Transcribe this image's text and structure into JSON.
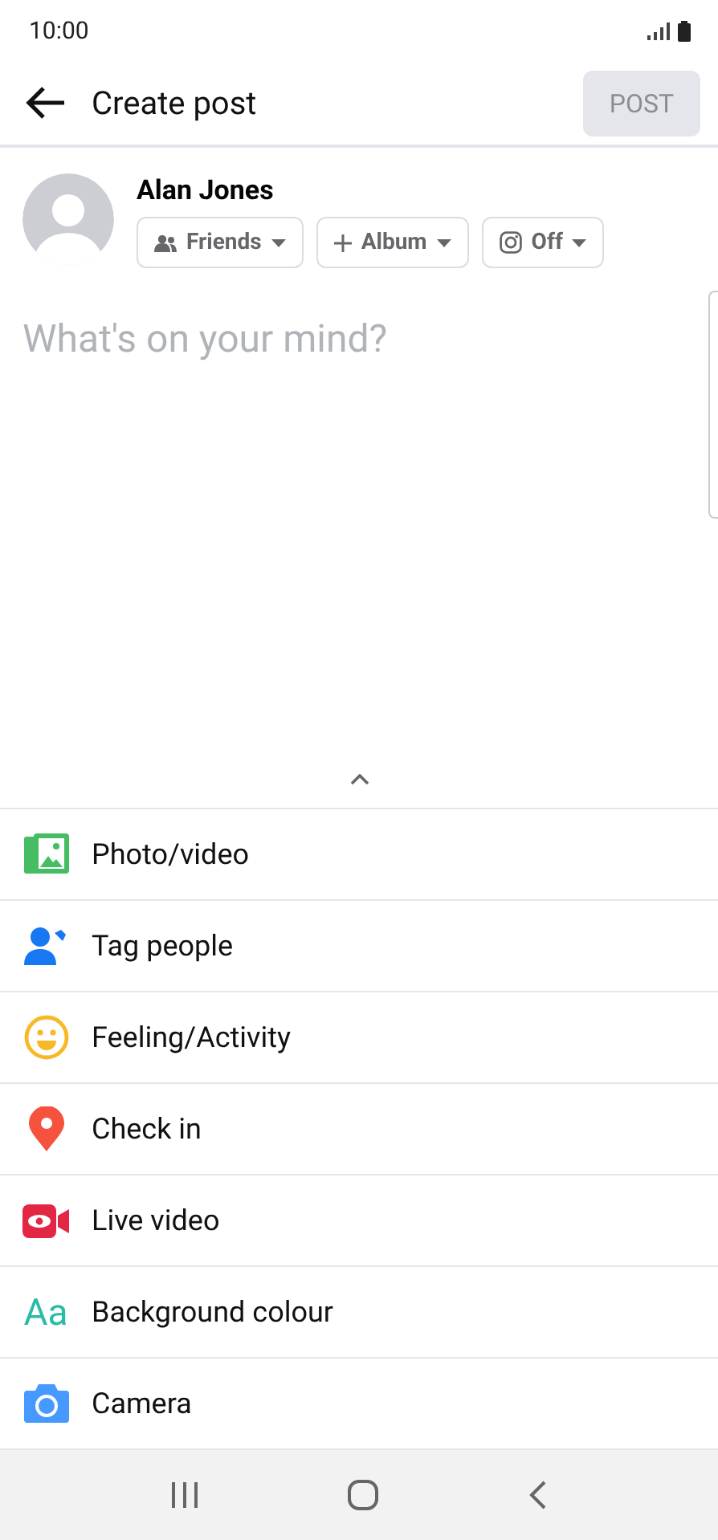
{
  "status_bar": {
    "time": "10:00"
  },
  "header": {
    "title": "Create post",
    "post_button": {
      "label": "POST",
      "disabled": true
    }
  },
  "author": {
    "name": "Alan Jones",
    "chips": [
      {
        "kind": "audience",
        "label": "Friends"
      },
      {
        "kind": "album",
        "label": "Album"
      },
      {
        "kind": "instagram",
        "label": "Off"
      }
    ]
  },
  "composer": {
    "placeholder": "What's on your mind?"
  },
  "options": [
    {
      "kind": "photo",
      "label": "Photo/video"
    },
    {
      "kind": "tag",
      "label": "Tag people"
    },
    {
      "kind": "feeling",
      "label": "Feeling/Activity"
    },
    {
      "kind": "checkin",
      "label": "Check in"
    },
    {
      "kind": "live",
      "label": "Live video"
    },
    {
      "kind": "background",
      "label": "Background colour",
      "icon_text": "Aa"
    },
    {
      "kind": "camera",
      "label": "Camera"
    }
  ]
}
